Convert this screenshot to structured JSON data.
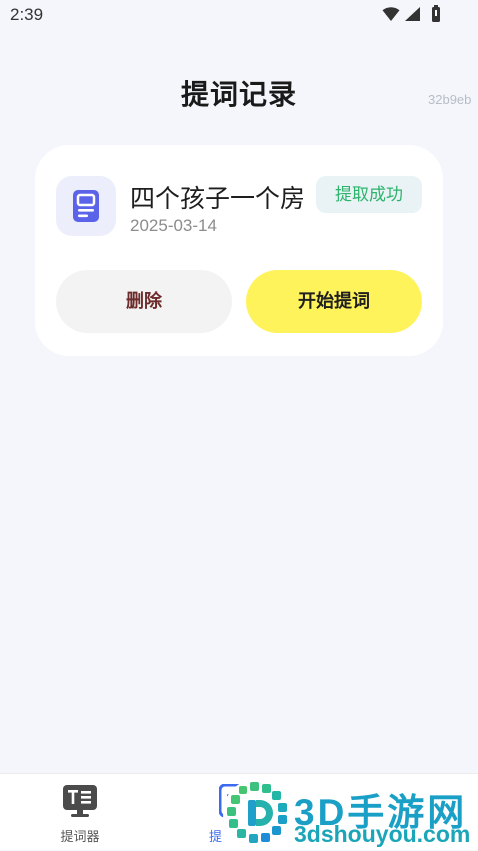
{
  "status_bar": {
    "time": "2:39",
    "icons": [
      "wifi-icon",
      "signal-icon",
      "battery-icon"
    ]
  },
  "header": {
    "title": "提词记录",
    "tag": "32b9eb"
  },
  "records": [
    {
      "icon": "document-icon",
      "title": "四个孩子一个房",
      "date": "2025-03-14",
      "status": "提取成功",
      "delete_label": "删除",
      "start_label": "开始提词"
    }
  ],
  "bottom_nav": {
    "items": [
      {
        "label": "提词器",
        "icon": "teleprompter-monitor-icon",
        "active": false
      },
      {
        "label": "提",
        "icon": "records-list-icon",
        "active": true
      }
    ]
  },
  "watermark": {
    "logo": "3dshouyou-logo-icon",
    "brand": "3D手游网",
    "domain": "3dshouyou.com"
  },
  "colors": {
    "background": "#f4f6fb",
    "card": "#ffffff",
    "accent_yellow": "#fff35c",
    "status_green": "#2db36c",
    "status_badge_bg": "#e9f3f6",
    "icon_blue": "#5b63e8",
    "delete_text": "#6d2b2b",
    "active_nav": "#3b6cf0",
    "watermark_teal": "#1a9fc6"
  }
}
